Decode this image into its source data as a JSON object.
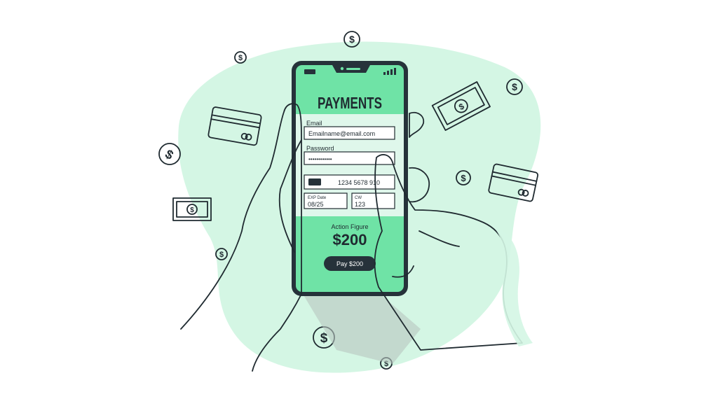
{
  "colors": {
    "blob": "#d4f6e4",
    "screen": "#6fe3a6",
    "screen_band": "#dff7eb",
    "phone": "#26323a",
    "ink": "#1f2a30",
    "white": "#ffffff"
  },
  "app": {
    "title": "PAYMENTS",
    "email_label": "Email",
    "email_value": "Emailname@email.com",
    "password_label": "Password",
    "password_value": "••••••••••••",
    "card_number": "1234 5678 910",
    "exp_label": "EXP Date",
    "exp_value": "08/25",
    "cvv_label": "CW",
    "cvv_value": "123",
    "product": "Action Figure",
    "amount": "$200",
    "pay_label": "Pay $200"
  },
  "icons": {
    "status_left": "battery-icon",
    "status_right": "signal-icon",
    "card_chip": "card-chip-icon",
    "floating": [
      "dollar-coin-icon",
      "credit-card-icon",
      "banknote-icon"
    ]
  }
}
